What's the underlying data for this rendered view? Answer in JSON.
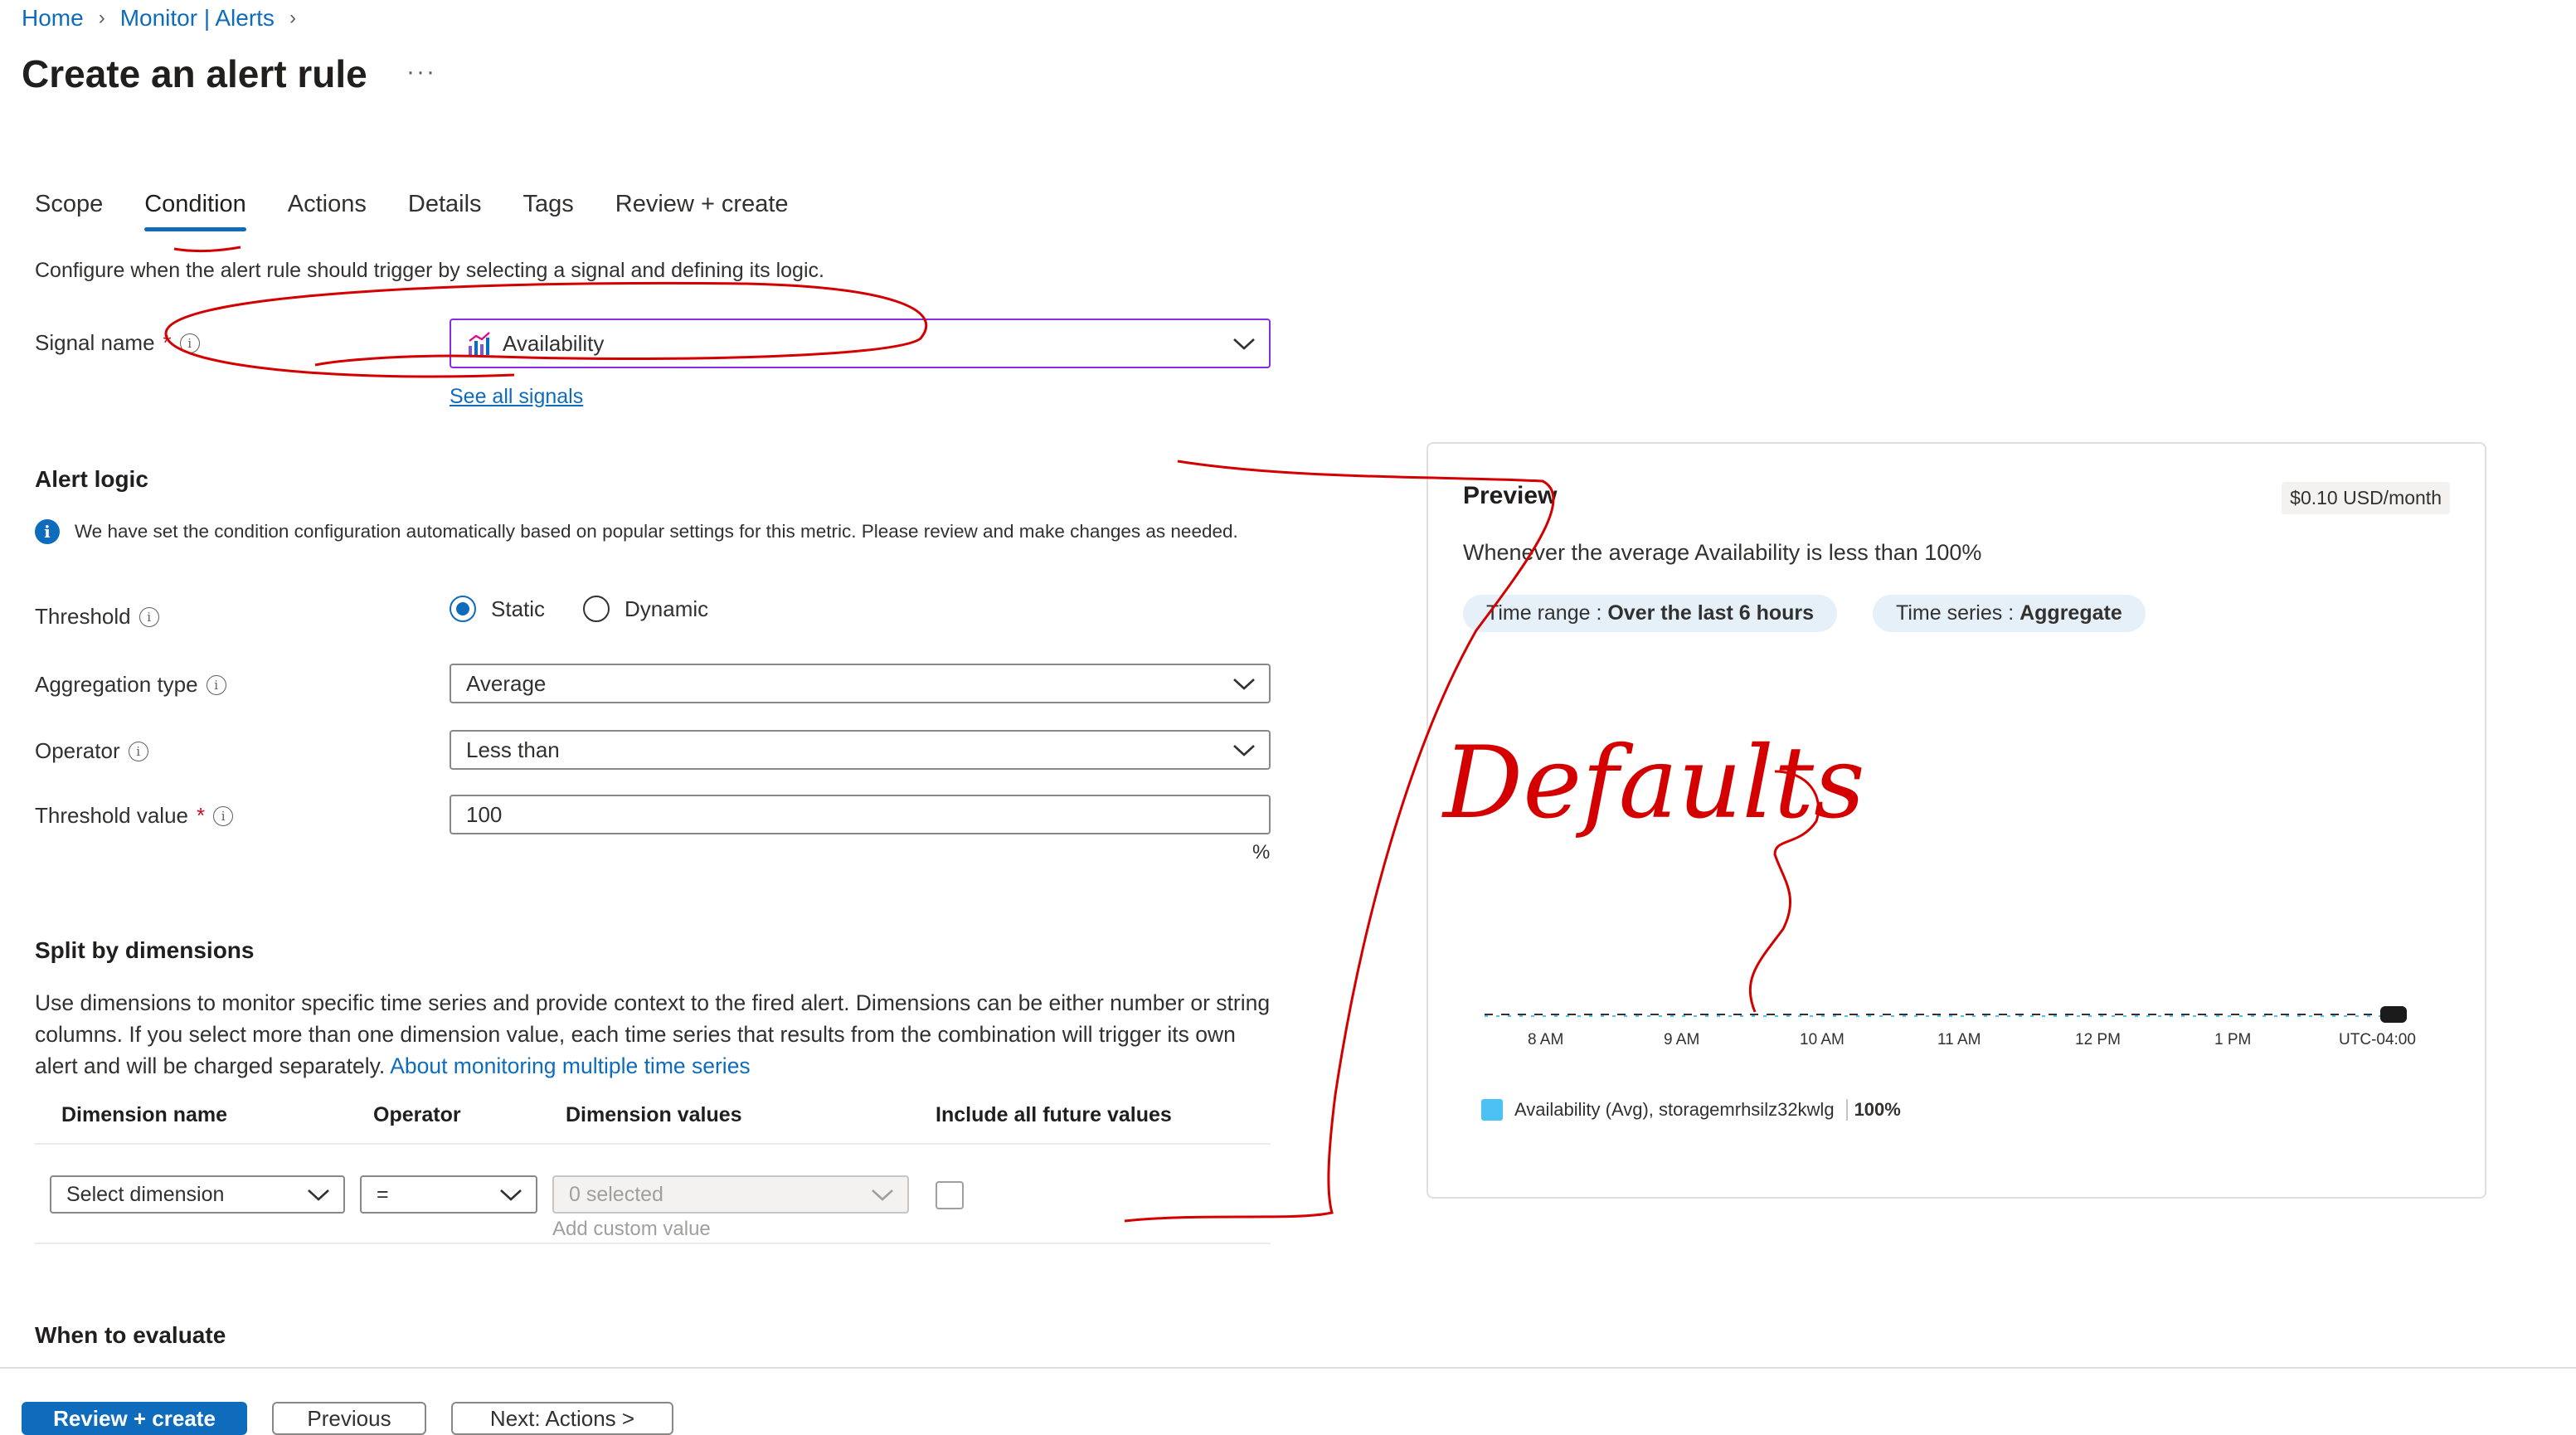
{
  "breadcrumb": {
    "home": "Home",
    "monitor": "Monitor | Alerts"
  },
  "page": {
    "title": "Create an alert rule",
    "more": "···"
  },
  "tabs": [
    {
      "label": "Scope"
    },
    {
      "label": "Condition"
    },
    {
      "label": "Actions"
    },
    {
      "label": "Details"
    },
    {
      "label": "Tags"
    },
    {
      "label": "Review + create"
    }
  ],
  "condition": {
    "description": "Configure when the alert rule should trigger by selecting a signal and defining its logic.",
    "signal_label": "Signal name",
    "required_mark": "*",
    "signal_value": "Availability",
    "see_all": "See all signals"
  },
  "alert_logic": {
    "heading": "Alert logic",
    "info": "We have set the condition configuration automatically based on popular settings for this metric. Please review and make changes as needed.",
    "threshold_label": "Threshold",
    "static_label": "Static",
    "dynamic_label": "Dynamic",
    "threshold_selected": "Static",
    "aggregation_label": "Aggregation type",
    "aggregation_value": "Average",
    "operator_label": "Operator",
    "operator_value": "Less than",
    "threshold_value_label": "Threshold value",
    "threshold_value": "100",
    "unit": "%"
  },
  "split": {
    "heading": "Split by dimensions",
    "text": "Use dimensions to monitor specific time series and provide context to the fired alert. Dimensions can be either number or string columns. If you select more than one dimension value, each time series that results from the combination will trigger its own alert and will be charged separately.",
    "link": "About monitoring multiple time series",
    "columns": [
      "Dimension name",
      "Operator",
      "Dimension values",
      "Include all future values"
    ],
    "row": {
      "dimension_placeholder": "Select dimension",
      "operator": "=",
      "values_placeholder": "0 selected",
      "custom": "Add custom value"
    }
  },
  "evaluate": {
    "heading": "When to evaluate"
  },
  "preview": {
    "title": "Preview",
    "price": "$0.10 USD/month",
    "summary": "Whenever the average Availability is less than 100%",
    "time_range_label": "Time range : ",
    "time_range_value": "Over the last 6 hours",
    "time_series_label": "Time series : ",
    "time_series_value": "Aggregate",
    "x_ticks": [
      "8 AM",
      "9 AM",
      "10 AM",
      "11 AM",
      "12 PM",
      "1 PM",
      "UTC-04:00"
    ],
    "legend_name": "Availability (Avg), storagemrhsilz32kwlg",
    "legend_value": "100%",
    "legend_color": "#4cc2f4"
  },
  "annotation": {
    "text": "Defaults"
  },
  "footer": {
    "primary": "Review + create",
    "previous": "Previous",
    "next": "Next: Actions >"
  },
  "colors": {
    "accent": "#0f6cbd",
    "signal_border": "#8a2be2",
    "annotation": "#d40000"
  }
}
